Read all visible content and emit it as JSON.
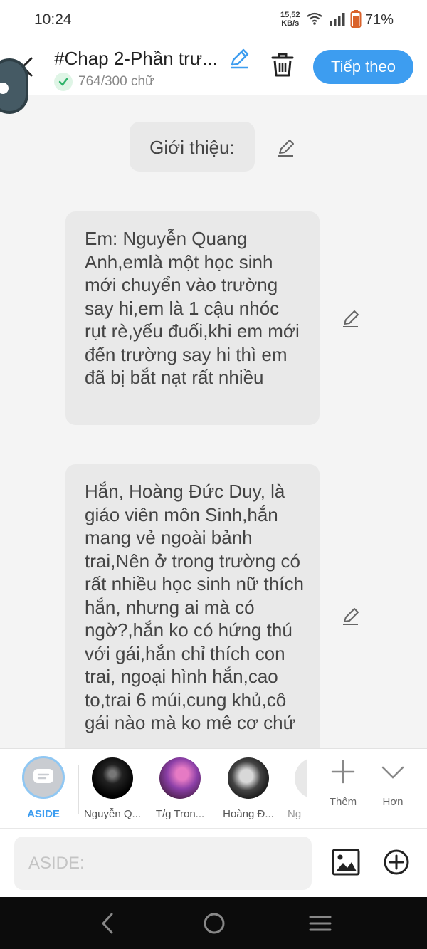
{
  "status_bar": {
    "time": "10:24",
    "net_speed_top": "15,52",
    "net_speed_bottom": "KB/s",
    "battery_pct": "71%"
  },
  "header": {
    "title": "#Chap 2-Phần trư...",
    "word_count": "764/300 chữ",
    "next_label": "Tiếp theo"
  },
  "messages": [
    {
      "text": "Giới thiệu:"
    },
    {
      "text": "Em: Nguyễn Quang Anh,emlà một học sinh mới chuyển vào trường say hi,em là 1 cậu nhóc rụt rè,yếu đuối,khi em mới đến trường say hi thì em đã bị bắt nạt rất nhiều"
    },
    {
      "text": "Hắn, Hoàng Đức Duy, là giáo viên môn Sinh,hắn mang vẻ ngoài bảnh trai,Nên ở trong trường có rất nhiều học sinh nữ thích hắn, nhưng ai mà có ngờ?,hắn ko có hứng thú với gái,hắn chỉ thích con trai, ngoại hình hắn,cao to,trai 6 múi,cung khủ,cô gái nào mà ko mê cơ chứ"
    }
  ],
  "characters": [
    {
      "name": "ASIDE"
    },
    {
      "name": "Nguyễn Q..."
    },
    {
      "name": "T/g Tron..."
    },
    {
      "name": "Hoàng Đ..."
    },
    {
      "name": "Ng"
    }
  ],
  "tools": {
    "more_label": "Thêm",
    "collapse_label": "Hơn"
  },
  "input": {
    "placeholder": "ASIDE:"
  },
  "colors": {
    "accent": "#3d9df0",
    "bubble": "#e9e9e9",
    "background": "#f4f4f4"
  }
}
